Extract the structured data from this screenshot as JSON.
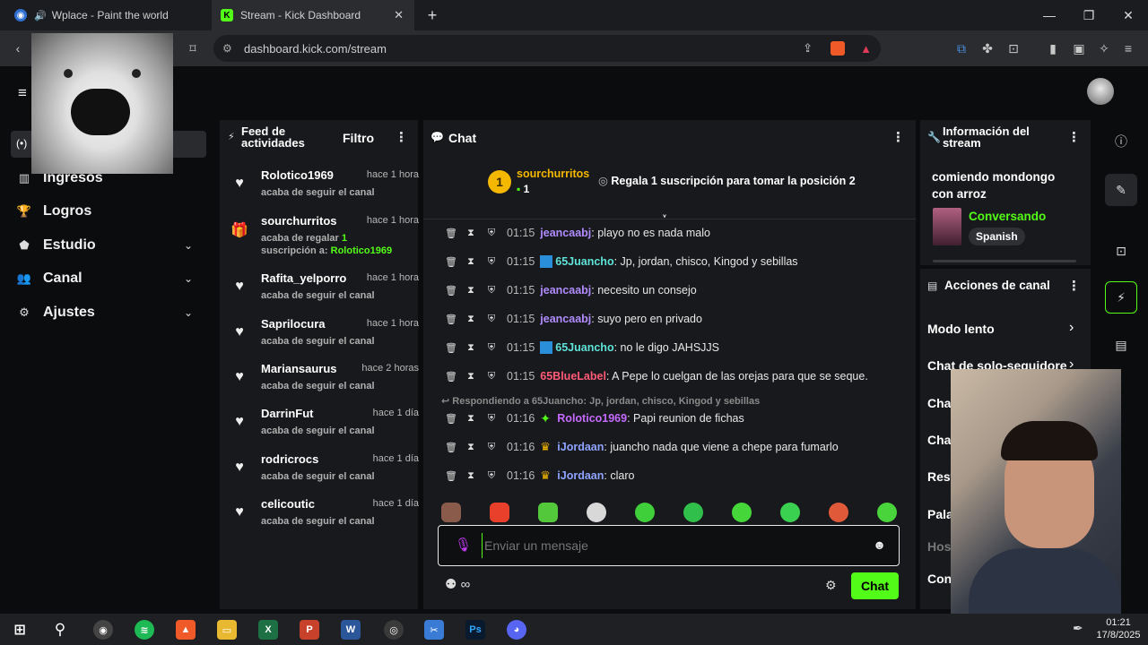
{
  "browser": {
    "tabs": [
      {
        "title": "Wplace - Paint the world",
        "active": false
      },
      {
        "title": "Stream - Kick Dashboard",
        "active": true
      }
    ],
    "url": "dashboard.kick.com/stream"
  },
  "sidenav": {
    "items": [
      {
        "label": "Ingresos"
      },
      {
        "label": "Logros"
      },
      {
        "label": "Estudio"
      },
      {
        "label": "Canal"
      },
      {
        "label": "Ajustes"
      }
    ]
  },
  "feed": {
    "title": "Feed de actividades",
    "filter_label": "Filtro",
    "items": [
      {
        "name": "Rolotico1969",
        "time": "hace 1 hora",
        "desc": "acaba de seguir el canal"
      },
      {
        "name": "sourchurritos",
        "time": "hace 1 hora",
        "desc_pre": "acaba de regalar",
        "desc_count": "1",
        "desc_mid": "suscripción a:",
        "desc_target": "Rolotico1969"
      },
      {
        "name": "Rafita_yelporro",
        "time": "hace 1 hora",
        "desc": "acaba de seguir el canal"
      },
      {
        "name": "Saprilocura",
        "time": "hace 1 hora",
        "desc": "acaba de seguir el canal"
      },
      {
        "name": "Mariansaurus",
        "time": "hace 2 horas",
        "desc": "acaba de seguir el canal"
      },
      {
        "name": "DarrinFut",
        "time": "hace 1 día",
        "desc": "acaba de seguir el canal"
      },
      {
        "name": "rodricrocs",
        "time": "hace 1 día",
        "desc": "acaba de seguir el canal"
      },
      {
        "name": "celicoutic",
        "time": "hace 1 día",
        "desc": "acaba de seguir el canal"
      }
    ]
  },
  "chat": {
    "title": "Chat",
    "pinned": {
      "user": "sourchurritos",
      "rank": "1",
      "count": "1",
      "text": "Regala 1 suscripción para tomar la posición 2"
    },
    "reply_note": "Respondiendo a 65Juancho: Jp, jordan, chisco, Kingod y sebillas",
    "messages": [
      {
        "time": "01:15",
        "user": "jeancaabj",
        "text": ": playo no es nada malo",
        "color": "#b18cff"
      },
      {
        "time": "01:15",
        "user": "65Juancho",
        "text": ": Jp, jordan, chisco, Kingod y sebillas",
        "color": "#5fe3d8"
      },
      {
        "time": "01:15",
        "user": "jeancaabj",
        "text": ": necesito un consejo",
        "color": "#b18cff"
      },
      {
        "time": "01:15",
        "user": "jeancaabj",
        "text": ": suyo pero en privado",
        "color": "#b18cff"
      },
      {
        "time": "01:15",
        "user": "65Juancho",
        "text": ": no le digo JAHSJJS",
        "color": "#5fe3d8"
      },
      {
        "time": "01:15",
        "user": "65BlueLabel",
        "text": ": A Pepe lo cuelgan de las orejas para que se seque.",
        "color": "#ff5a78"
      },
      {
        "time": "01:16",
        "user": "Rolotico1969",
        "text": ": Papi reunion de fichas",
        "color": "#c56bff"
      },
      {
        "time": "01:16",
        "user": "iJordaan",
        "text": ": juancho nada que viene a chepe para fumarlo",
        "color": "#8fa4ff"
      },
      {
        "time": "01:16",
        "user": "iJordaan",
        "text": ": claro",
        "color": "#8fa4ff"
      }
    ],
    "input_placeholder": "Enviar un mensaje",
    "send_label": "Chat",
    "mode_symbol": "∞"
  },
  "stream_info": {
    "title": "Información del stream",
    "stream_title": "comiendo mondongo con arroz",
    "category": "Conversando",
    "language": "Spanish"
  },
  "channel_actions": {
    "title": "Acciones de canal",
    "items": [
      "Modo lento",
      "Chat de solo-seguidore",
      "Cha",
      "Cha",
      "Rest",
      "Pala",
      "Hos",
      "Con"
    ]
  },
  "taskbar": {
    "time": "01:21",
    "date": "17/8/2025"
  },
  "colors": {
    "kick_green": "#53fc18",
    "panel_bg": "#18191c",
    "page_bg": "#0b0c0e"
  }
}
